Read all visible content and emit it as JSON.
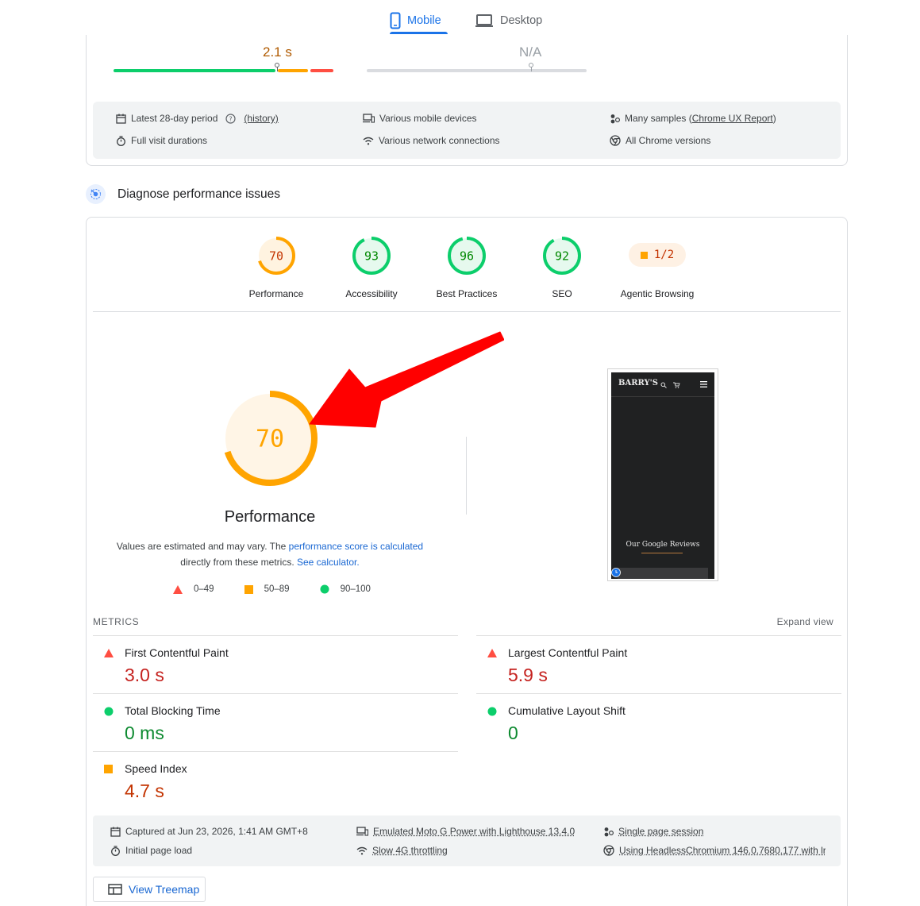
{
  "tabs": {
    "mobile": "Mobile",
    "desktop": "Desktop",
    "active": "mobile"
  },
  "field_data": {
    "metric_1": {
      "value": "2.1 s",
      "color": "#b05a00"
    },
    "metric_2": {
      "value": "N/A"
    },
    "info": {
      "period": "Latest 28-day period",
      "history": "(history)",
      "devices": "Various mobile devices",
      "samples_prefix": "Many samples (",
      "samples_link": "Chrome UX Report",
      "samples_suffix": ")",
      "durations": "Full visit durations",
      "network": "Various network connections",
      "versions": "All Chrome versions"
    }
  },
  "diagnose": {
    "title": "Diagnose performance issues"
  },
  "categories": [
    {
      "label": "Performance",
      "score": "70",
      "fraction": 0.7,
      "color": "#ffa400",
      "text_color": "#c33300",
      "bg": "#fff3e0"
    },
    {
      "label": "Accessibility",
      "score": "93",
      "fraction": 0.93,
      "color": "#0cce6b",
      "text_color": "#008800",
      "bg": "#e6f9ee"
    },
    {
      "label": "Best Practices",
      "score": "96",
      "fraction": 0.96,
      "color": "#0cce6b",
      "text_color": "#008800",
      "bg": "#e6f9ee"
    },
    {
      "label": "SEO",
      "score": "92",
      "fraction": 0.92,
      "color": "#0cce6b",
      "text_color": "#008800",
      "bg": "#e6f9ee"
    }
  ],
  "agentic": {
    "label": "Agentic Browsing",
    "score": "1/2"
  },
  "performance": {
    "score": "70",
    "fraction": 0.7,
    "label": "Performance",
    "estimate_1": "Values are estimated and may vary. The ",
    "estimate_link_1": "performance score is calculated",
    "estimate_2": "directly from these metrics. ",
    "estimate_link_2": "See calculator."
  },
  "legend": {
    "fail": "0–49",
    "average": "50–89",
    "pass": "90–100"
  },
  "screenshot": {
    "logo": "BARRY'S",
    "reviews": "Our Google Reviews"
  },
  "metrics": {
    "heading": "METRICS",
    "expand": "Expand view",
    "fcp": {
      "name": "First Contentful Paint",
      "value": "3.0 s",
      "rating": "fail"
    },
    "lcp": {
      "name": "Largest Contentful Paint",
      "value": "5.9 s",
      "rating": "fail"
    },
    "tbt": {
      "name": "Total Blocking Time",
      "value": "0 ms",
      "rating": "pass"
    },
    "cls": {
      "name": "Cumulative Layout Shift",
      "value": "0",
      "rating": "pass"
    },
    "si": {
      "name": "Speed Index",
      "value": "4.7 s",
      "rating": "average"
    }
  },
  "run_info": {
    "captured": "Captured at Jun 23, 2026, 1:41 AM GMT+8",
    "load": "Initial page load",
    "device": "Emulated Moto G Power with Lighthouse 13.4.0",
    "throttling": "Slow 4G throttling",
    "session": "Single page session",
    "browser": "Using HeadlessChromium 146.0.7680.177 with lr"
  },
  "treemap": {
    "label": "View Treemap"
  },
  "colors": {
    "fail": "#ff4e42",
    "average": "#ffa400",
    "pass": "#0cce6b",
    "link": "#1967d2",
    "accent": "#1a73e8"
  }
}
